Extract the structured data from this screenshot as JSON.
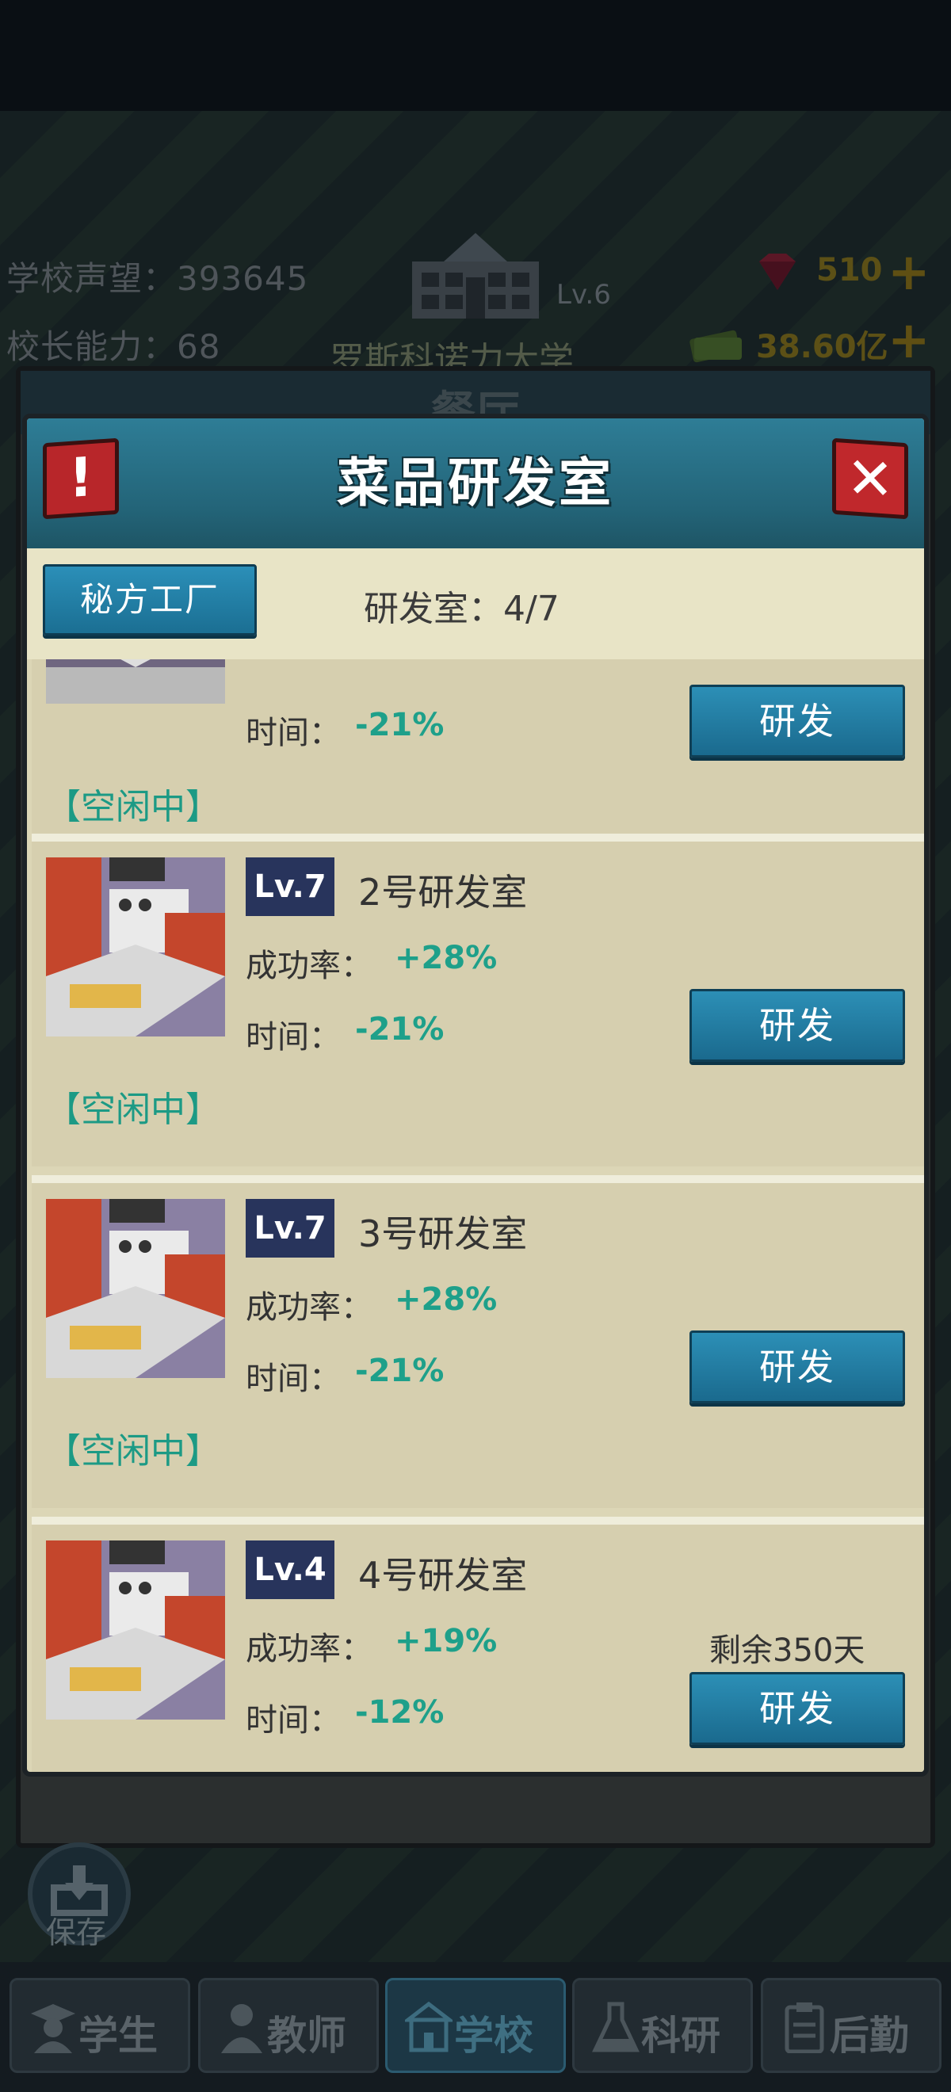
{
  "hud": {
    "reputation_label": "学校声望：393645",
    "ability_label": "校长能力：68",
    "school_level": "Lv.6",
    "school_name": "罗斯科诺力大学",
    "gems": "510",
    "cash": "38.60亿",
    "behind_panel_title": "餐厅"
  },
  "modal": {
    "title": "菜品研发室",
    "alert_symbol": "!",
    "close_symbol": "✕",
    "tab_label": "秘方工厂",
    "lab_count": "研发室：4/7"
  },
  "labs": [
    {
      "level": "",
      "name": "",
      "success_label": "",
      "success_value": "",
      "time_label": "时间：",
      "time_value": "-21%",
      "status": "【空闲中】",
      "remaining": "",
      "button": "研发"
    },
    {
      "level": "Lv.7",
      "name": "2号研发室",
      "success_label": "成功率：",
      "success_value": "+28%",
      "time_label": "时间：",
      "time_value": "-21%",
      "status": "【空闲中】",
      "remaining": "",
      "button": "研发"
    },
    {
      "level": "Lv.7",
      "name": "3号研发室",
      "success_label": "成功率：",
      "success_value": "+28%",
      "time_label": "时间：",
      "time_value": "-21%",
      "status": "【空闲中】",
      "remaining": "",
      "button": "研发"
    },
    {
      "level": "Lv.4",
      "name": "4号研发室",
      "success_label": "成功率：",
      "success_value": "+19%",
      "time_label": "时间：",
      "time_value": "-12%",
      "status": "",
      "remaining": "剩余350天",
      "button": "研发"
    }
  ],
  "save_label": "保存",
  "nav": [
    {
      "label": "学生",
      "icon": "student-icon",
      "active": false
    },
    {
      "label": "教师",
      "icon": "teacher-icon",
      "active": false
    },
    {
      "label": "学校",
      "icon": "school-icon",
      "active": true
    },
    {
      "label": "科研",
      "icon": "flask-icon",
      "active": false
    },
    {
      "label": "后勤",
      "icon": "clipboard-icon",
      "active": false
    }
  ],
  "colors": {
    "header": "#236478",
    "accent_button": "#1f7aa3",
    "positive_value": "#1ea08a",
    "level_badge": "#28345c",
    "card_bg": "#d6cfaf"
  }
}
